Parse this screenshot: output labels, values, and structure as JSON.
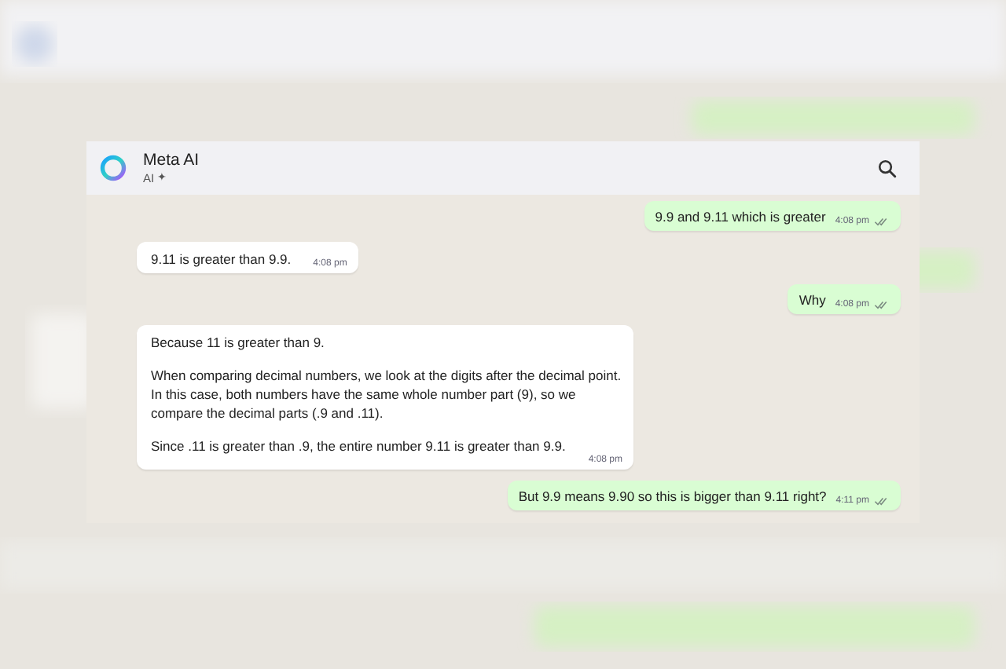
{
  "chat": {
    "name": "Meta AI",
    "subtitle": "AI",
    "verified_mark": "✦"
  },
  "messages": [
    {
      "kind": "outgoing",
      "paragraphs": [
        "9.9 and 9.11 which is greater"
      ],
      "time": "4:08 pm"
    },
    {
      "kind": "incoming",
      "paragraphs": [
        "9.11 is greater than 9.9."
      ],
      "time": "4:08 pm"
    },
    {
      "kind": "outgoing",
      "paragraphs": [
        "Why"
      ],
      "time": "4:08 pm"
    },
    {
      "kind": "incoming",
      "paragraphs": [
        "Because 11 is greater than 9.",
        "When comparing decimal numbers, we look at the digits after the decimal point. In this case, both numbers have the same whole number part (9), so we compare the decimal parts (.9 and .11).",
        "Since .11 is greater than .9, the entire number 9.11 is greater than 9.9."
      ],
      "time": "4:08 pm"
    },
    {
      "kind": "outgoing",
      "paragraphs": [
        "But 9.9 means 9.90 so this is bigger than 9.11 right?"
      ],
      "time": "4:11 pm"
    }
  ]
}
